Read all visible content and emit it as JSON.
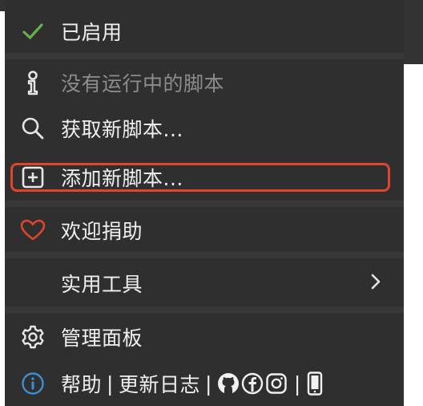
{
  "colors": {
    "menu_bg": "#2f2f2f",
    "separator": "#383838",
    "text": "#f1f1f1",
    "muted_text": "#8c8c8c",
    "check": "#67b04c",
    "heart": "#e0452c",
    "info": "#3a8fd0",
    "highlight_border": "#e0452c"
  },
  "menu": {
    "enabled_label": "已启用",
    "no_scripts_label": "没有运行中的脚本",
    "get_scripts_label": "获取新脚本...",
    "add_script_label": "添加新脚本...",
    "donate_label": "欢迎捐助",
    "utilities_label": "实用工具",
    "dashboard_label": "管理面板",
    "help_label": "帮助",
    "changelog_label": "更新日志",
    "footer_separator": "|"
  },
  "icons": {
    "enabled": "check-icon",
    "no_scripts": "info-i-icon",
    "get_scripts": "search-icon",
    "add_script": "plus-square-icon",
    "donate": "heart-icon",
    "utilities": "chevron-right-icon",
    "dashboard": "gear-icon",
    "help": "info-circle-icon",
    "github": "github-icon",
    "facebook": "facebook-icon",
    "instagram": "instagram-icon",
    "mobile": "mobile-icon"
  }
}
